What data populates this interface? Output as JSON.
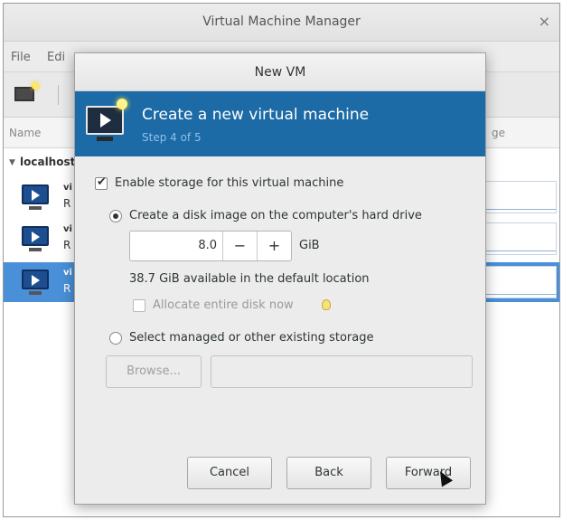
{
  "main_window": {
    "title": "Virtual Machine Manager",
    "close_glyph": "×",
    "menu": [
      "File",
      "Edi",
      "",
      "",
      ""
    ],
    "columns": {
      "name": "Name",
      "usage": "ge"
    },
    "host": {
      "label": "localhost"
    },
    "vms": [
      {
        "name": "vi",
        "state": "R",
        "selected": false
      },
      {
        "name": "vi",
        "state": "R",
        "selected": false
      },
      {
        "name": "vi",
        "state": "R",
        "selected": true
      }
    ]
  },
  "dialog": {
    "title": "New VM",
    "banner": {
      "title": "Create a new virtual machine",
      "step": "Step 4 of 5",
      "color": "#1c6aa6"
    },
    "enable_storage": {
      "label": "Enable storage for this virtual machine",
      "checked": true
    },
    "create_disk": {
      "label": "Create a disk image on the computer's hard drive",
      "selected": true
    },
    "disk_size": {
      "value": "8.0",
      "unit": "GiB",
      "minus": "−",
      "plus": "+"
    },
    "available_text": "38.7 GiB available in the default location",
    "allocate": {
      "label": "Allocate entire disk now",
      "checked": false,
      "enabled": false
    },
    "select_managed": {
      "label": "Select managed or other existing storage",
      "selected": false
    },
    "browse_label": "Browse...",
    "path_value": "",
    "buttons": {
      "cancel": "Cancel",
      "back": "Back",
      "forward": "Forward"
    }
  },
  "icons": [
    "new-vm-icon",
    "vm-icon",
    "create-vm-banner-icon",
    "lightbulb-icon",
    "mouse-cursor-icon"
  ]
}
